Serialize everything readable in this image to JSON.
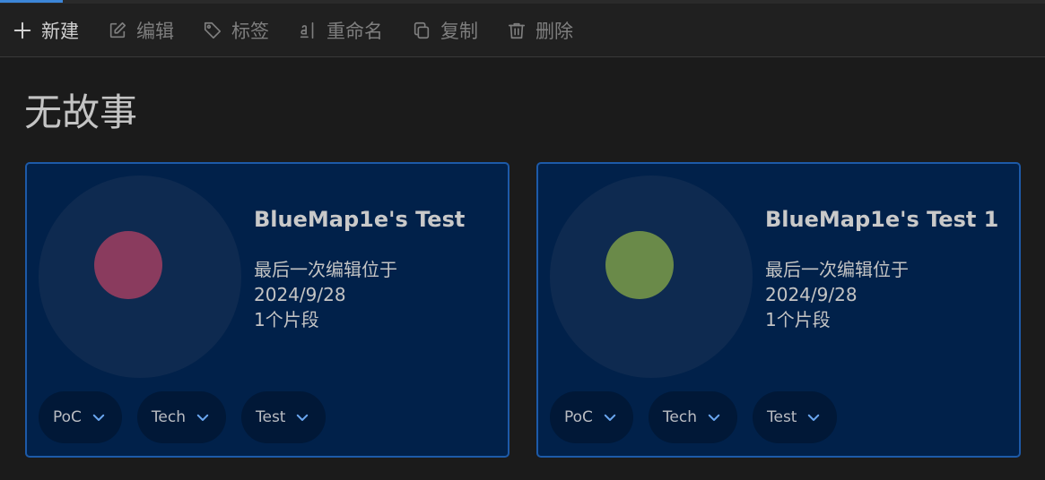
{
  "toolbar": {
    "items": [
      {
        "label": "新建",
        "icon": "plus-icon"
      },
      {
        "label": "编辑",
        "icon": "edit-icon"
      },
      {
        "label": "标签",
        "icon": "tag-icon"
      },
      {
        "label": "重命名",
        "icon": "rename-icon"
      },
      {
        "label": "复制",
        "icon": "copy-icon"
      },
      {
        "label": "删除",
        "icon": "trash-icon"
      }
    ]
  },
  "page": {
    "title": "无故事"
  },
  "cards": [
    {
      "name": "BlueMap1e's Test",
      "last_edit_label": "最后一次编辑位于",
      "last_edit_date": "2024/9/28",
      "segments": "1个片段",
      "dot_color": "#8a3b5e",
      "tags": [
        "PoC",
        "Tech",
        "Test"
      ]
    },
    {
      "name": "BlueMap1e's Test 1",
      "last_edit_label": "最后一次编辑位于",
      "last_edit_date": "2024/9/28",
      "segments": "1个片段",
      "dot_color": "#6a8a49",
      "tags": [
        "PoC",
        "Tech",
        "Test"
      ]
    }
  ],
  "colors": {
    "accent": "#3c86d8",
    "card_bg": "#01214a",
    "card_border": "#1d5aa8"
  }
}
